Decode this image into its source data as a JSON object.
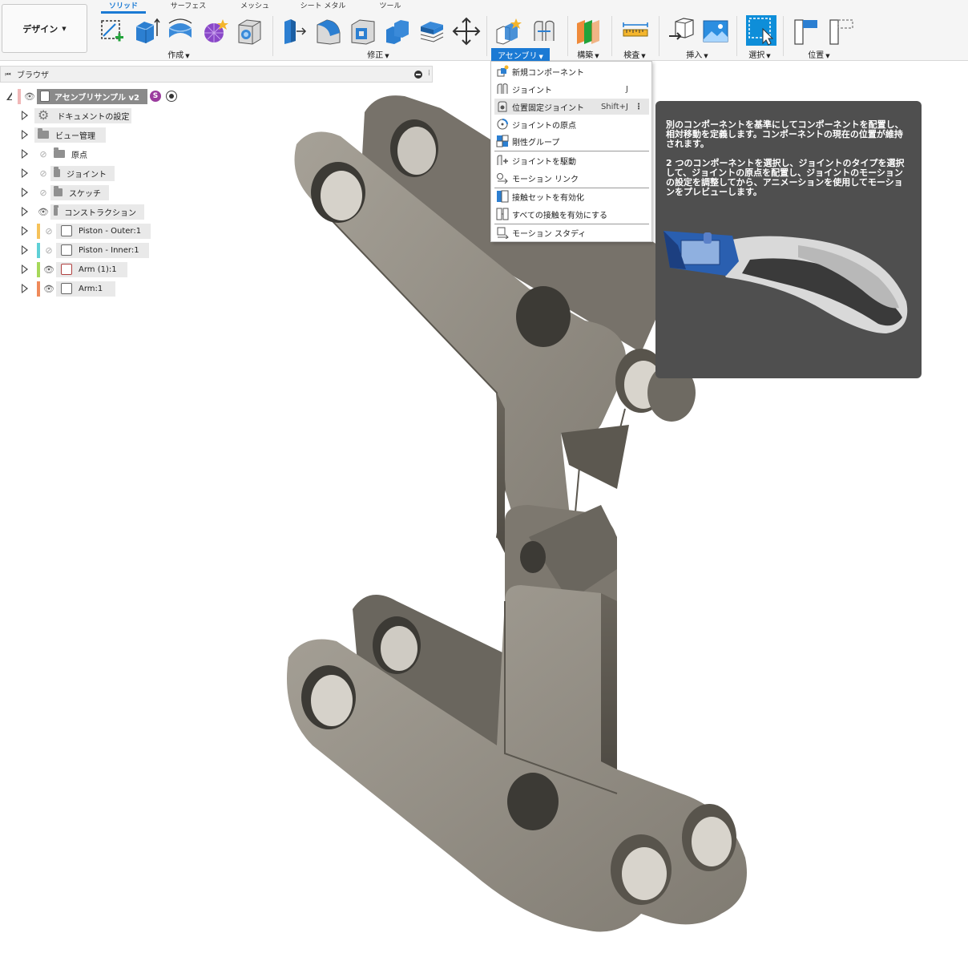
{
  "workspace": {
    "label": "デザイン"
  },
  "tabs": [
    {
      "label": "ソリッド",
      "active": true
    },
    {
      "label": "サーフェス",
      "active": false
    },
    {
      "label": "メッシュ",
      "active": false
    },
    {
      "label": "シート メタル",
      "active": false
    },
    {
      "label": "ツール",
      "active": false
    }
  ],
  "groups": {
    "create": "作成",
    "modify": "修正",
    "assemble": "アセンブリ",
    "construct": "構築",
    "inspect": "検査",
    "insert": "挿入",
    "select": "選択",
    "position": "位置"
  },
  "colors": {
    "accent": "#1b7ad4",
    "part_fill": "#8f8a80",
    "tooltip_bg": "#4f4f4f"
  },
  "browser": {
    "title": "ブラウザ",
    "root": {
      "label": "アセンブリサンプル v2",
      "badge": "S"
    },
    "items": [
      {
        "label": "ドキュメントの設定",
        "icon": "gear-icon"
      },
      {
        "label": "ビュー管理",
        "icon": "folder-icon"
      },
      {
        "label": "原点",
        "icon": "folder-icon",
        "visible": false
      },
      {
        "label": "ジョイント",
        "icon": "folder-icon",
        "visible": false
      },
      {
        "label": "スケッチ",
        "icon": "folder-icon",
        "visible": false
      },
      {
        "label": "コンストラクション",
        "icon": "folder-icon",
        "visible": true
      },
      {
        "label": "Piston - Outer:1",
        "icon": "component-icon",
        "visible": false,
        "color": "#f6c25a"
      },
      {
        "label": "Piston - Inner:1",
        "icon": "component-icon",
        "visible": false,
        "color": "#5fd0d6"
      },
      {
        "label": "Arm (1):1",
        "icon": "component-icon",
        "visible": true,
        "color": "#a6d85a"
      },
      {
        "label": "Arm:1",
        "icon": "component-icon",
        "visible": true,
        "color": "#ef8a5a"
      }
    ]
  },
  "assemble_menu": {
    "items": [
      {
        "label": "新規コンポーネント",
        "icon": "new-component-icon"
      },
      {
        "label": "ジョイント",
        "icon": "joint-icon",
        "shortcut": "J"
      },
      {
        "label": "位置固定ジョイント",
        "icon": "as-built-joint-icon",
        "shortcut": "Shift+J",
        "more": "⋮"
      },
      {
        "label": "ジョイントの原点",
        "icon": "joint-origin-icon"
      },
      {
        "label": "剛性グループ",
        "icon": "rigid-group-icon"
      },
      {
        "label": "ジョイントを駆動",
        "icon": "drive-joints-icon"
      },
      {
        "label": "モーション リンク",
        "icon": "motion-link-icon"
      },
      {
        "label": "接触セットを有効化",
        "icon": "enable-contact-icon"
      },
      {
        "label": "すべての接触を有効にする",
        "icon": "enable-all-contact-icon"
      },
      {
        "label": "モーション スタディ",
        "icon": "motion-study-icon"
      }
    ]
  },
  "tooltip": {
    "paragraph1": "別のコンポーネントを基準にしてコンポーネントを配置し、相対移動を定義します。コンポーネントの現在の位置が維持されます。",
    "paragraph2": "2 つのコンポーネントを選択し、ジョイントのタイプを選択して、ジョイントの原点を配置し、ジョイントのモーションの設定を調整してから、アニメーションを使用してモーションをプレビューします。"
  }
}
